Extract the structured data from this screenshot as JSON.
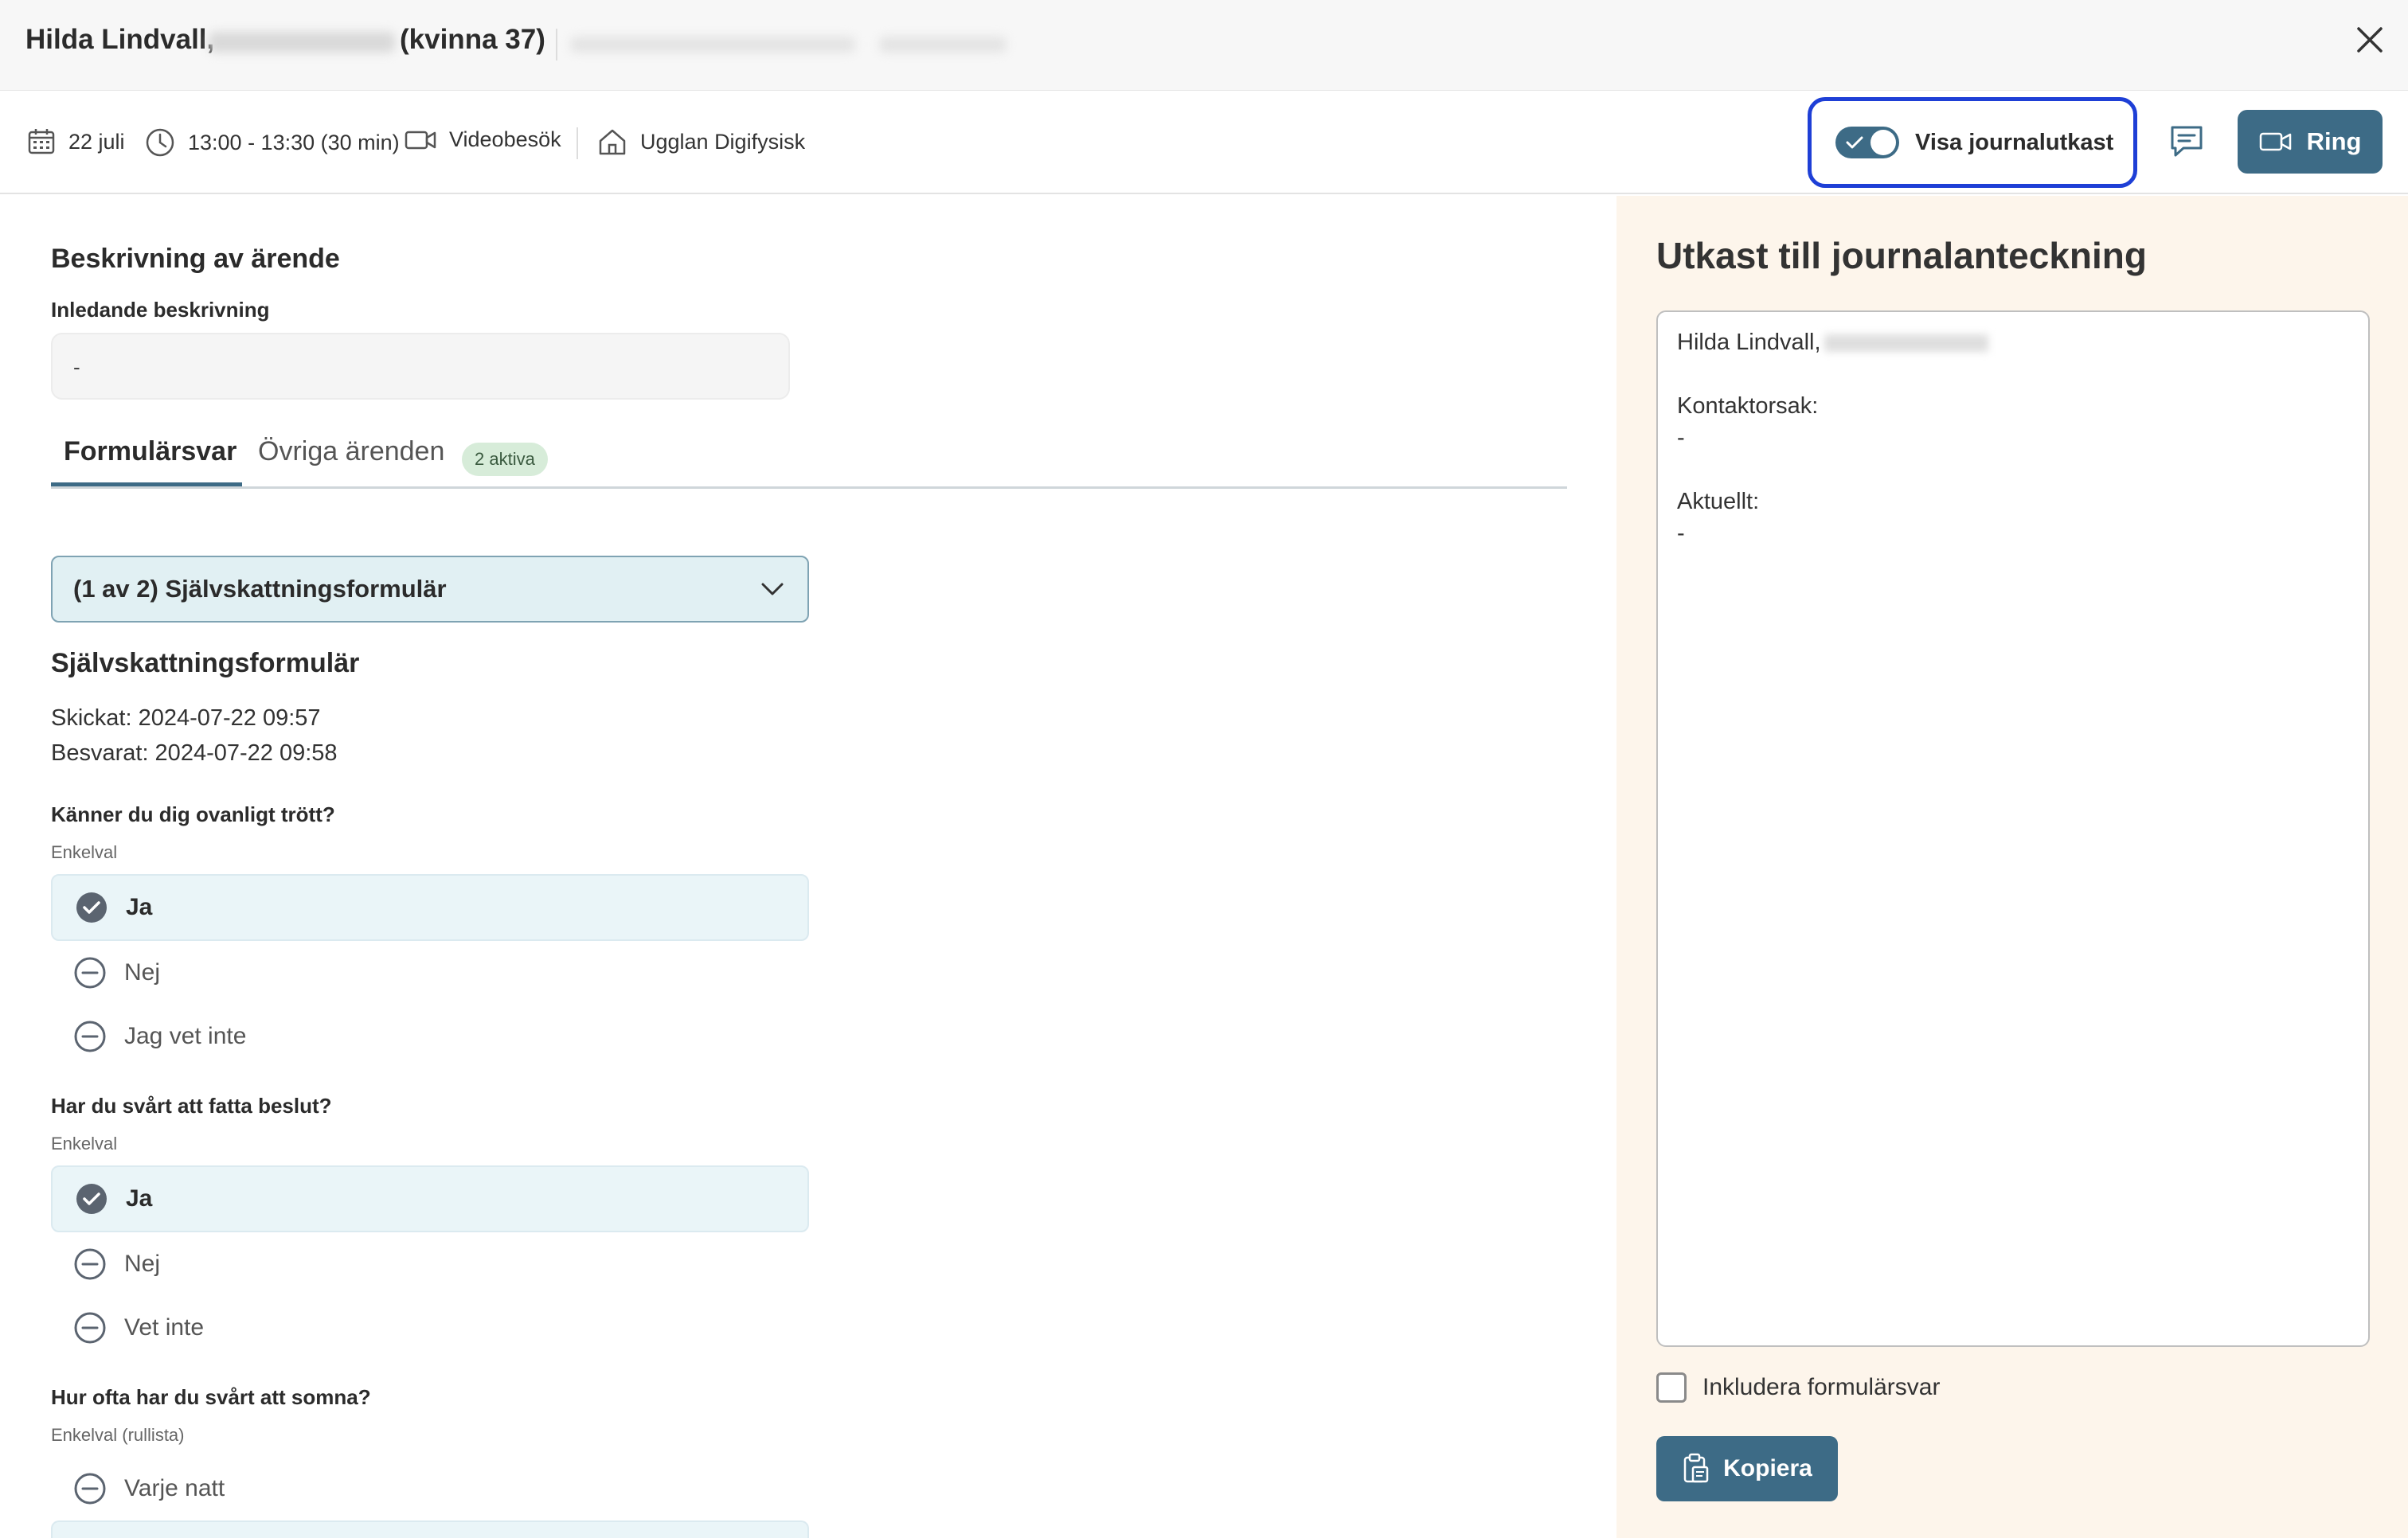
{
  "header": {
    "patient_name": "Hilda Lindvall,",
    "patient_meta": "(kvinna 37)"
  },
  "subheader": {
    "date": "22 juli",
    "time": "13:00 - 13:30 (30 min)",
    "visit_type": "Videobesök",
    "clinic": "Ugglan Digifysisk",
    "toggle_label": "Visa journalutkast",
    "ring_label": "Ring"
  },
  "case": {
    "section_title": "Beskrivning av ärende",
    "initial_label": "Inledande beskrivning",
    "initial_value": "-"
  },
  "tabs": {
    "form_answers": "Formulärsvar",
    "other_cases": "Övriga ärenden",
    "badge": "2 aktiva"
  },
  "form": {
    "select_value": "(1 av 2) Självskattningsformulär",
    "title": "Självskattningsformulär",
    "sent": "Skickat: 2024-07-22 09:57",
    "answered": "Besvarat: 2024-07-22 09:58",
    "questions": [
      {
        "title": "Känner du dig ovanligt trött?",
        "type": "Enkelval",
        "options": [
          "Ja",
          "Nej",
          "Jag vet inte"
        ]
      },
      {
        "title": "Har du svårt att fatta beslut?",
        "type": "Enkelval",
        "options": [
          "Ja",
          "Nej",
          "Vet inte"
        ]
      },
      {
        "title": "Hur ofta har du svårt att somna?",
        "type": "Enkelval (rullista)",
        "options": [
          "Varje natt"
        ]
      }
    ]
  },
  "journal": {
    "title": "Utkast till journalanteckning",
    "line_name": "Hilda Lindvall,",
    "contact_label": "Kontaktorsak:",
    "contact_value": "-",
    "current_label": "Aktuellt:",
    "current_value": "-",
    "include_label": "Inkludera formulärsvar",
    "copy_label": "Kopiera"
  },
  "colors": {
    "accent": "#3d6b86",
    "focus_ring": "#1e3fd6",
    "panel_bg": "#fdf5eb",
    "select_bg": "#e1f0f3",
    "badge_bg": "#d7ecd9"
  }
}
